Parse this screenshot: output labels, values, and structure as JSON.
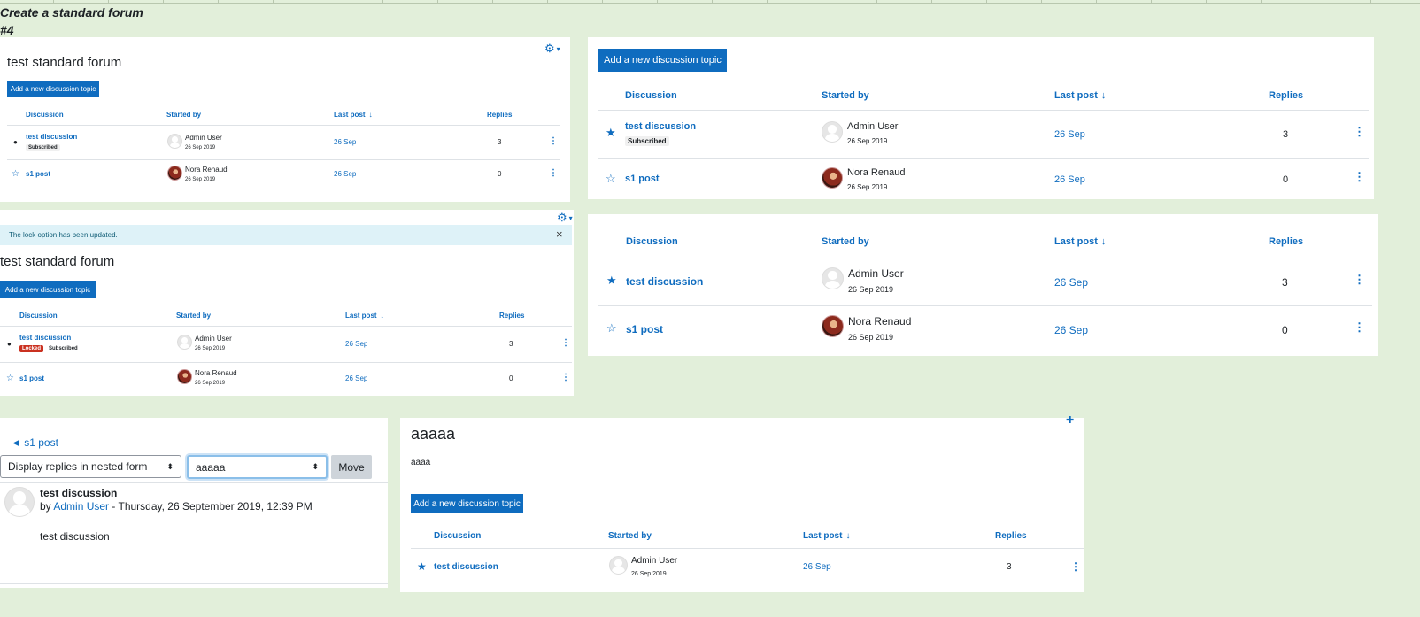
{
  "sheet": {
    "title": "Create a standard forum",
    "subtitle": "#4"
  },
  "common": {
    "col_discussion": "Discussion",
    "col_started_by": "Started by",
    "col_last_post": "Last post",
    "col_replies": "Replies",
    "sort_arrow": "↓",
    "add_topic": "Add a new discussion topic",
    "forum_title": "test standard forum",
    "badge_subscribed": "Subscribed",
    "badge_locked": "Locked",
    "kebab": "⋮",
    "star_filled": "★",
    "star_empty": "☆",
    "pin": "📍",
    "gear": "⚙",
    "caret": "▾"
  },
  "rows": {
    "r1": {
      "discussion": "test discussion",
      "author": "Admin User",
      "date": "26 Sep 2019",
      "last_post": "26 Sep",
      "replies": "3"
    },
    "r2": {
      "discussion": "s1 post",
      "author": "Nora Renaud",
      "date": "26 Sep 2019",
      "last_post": "26 Sep",
      "replies": "0"
    }
  },
  "panel3": {
    "alert": "The lock option has been updated.",
    "close": "×"
  },
  "panel5": {
    "back_link": "◄ s1 post",
    "display_select": "Display replies in nested form",
    "move_select": "aaaaa",
    "move_button": "Move",
    "select_arrows": "⬍",
    "post_title": "test discussion",
    "post_by": "by",
    "post_author": "Admin User",
    "post_date": " - Thursday, 26 September 2019, 12:39 PM",
    "post_body": "test discussion"
  },
  "panel6": {
    "title": "aaaaa",
    "description": "aaaa",
    "top_icon": "✚"
  }
}
